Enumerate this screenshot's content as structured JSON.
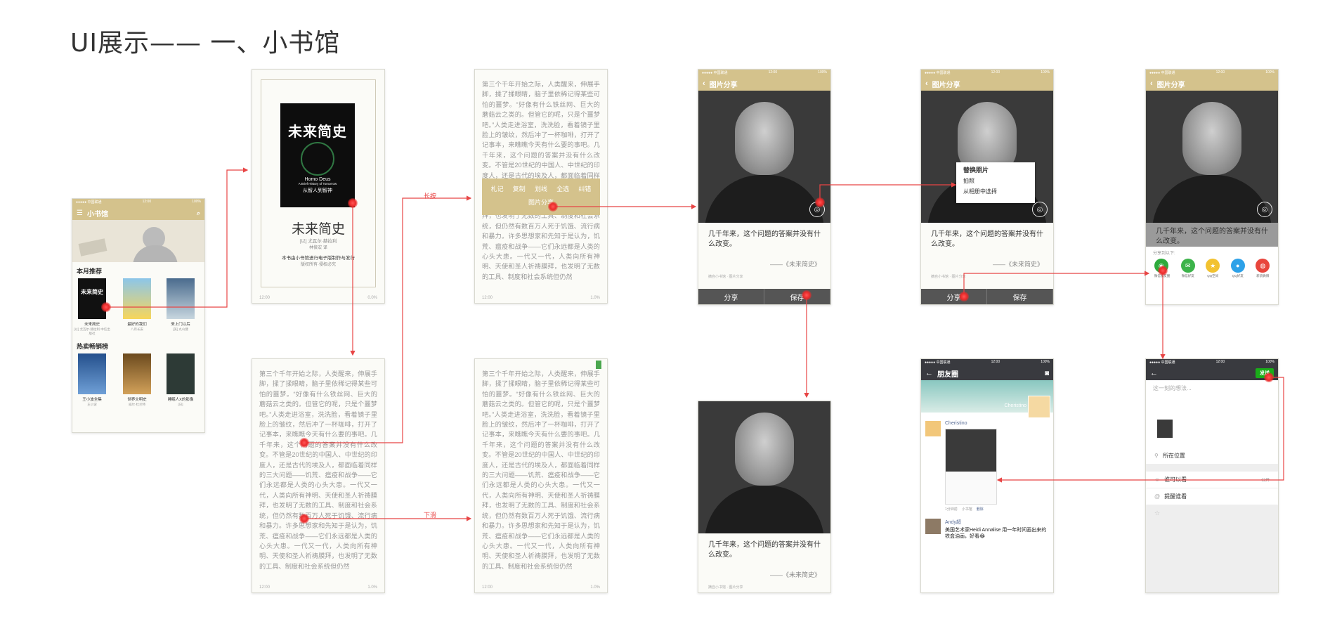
{
  "page": {
    "title": "UI展示—— 一、小书馆"
  },
  "flow_labels": {
    "long_press": "长按",
    "slide_down": "下滑"
  },
  "home": {
    "status_left": "●●●●● 中国联通",
    "status_time": "12:00",
    "status_right": "100%",
    "nav_title": "小书馆",
    "section_recommend": "本月推荐",
    "section_hot": "热卖畅销榜",
    "recommend_books": [
      {
        "title": "未来简史",
        "author": "[以] 尤瓦尔·赫拉利 中信出版社"
      },
      {
        "title": "最好的我们",
        "author": "八月长安"
      },
      {
        "title": "来上门以后",
        "author": "[美] 丸山健"
      }
    ],
    "hot_books": [
      {
        "title": "王小波全集",
        "author": "王小波"
      },
      {
        "title": "世界文明史",
        "author": "威尔·杜兰特"
      },
      {
        "title": "睡眠人X的影像",
        "author": "[日]"
      }
    ]
  },
  "cover": {
    "book_cover_title": "未来简史",
    "book_cover_en": "Homo Deus",
    "book_cover_en_sub": "A Brief History of Tomorrow",
    "book_cover_cn_sub": "从智人到智神",
    "title": "未来简史",
    "author": "[以] 尤瓦尔·赫拉利",
    "translator": "林俊宏 译",
    "note1": "本书由小书馆进行电子版制作与发行",
    "note2": "版权所有·侵权必究",
    "foot_left": "12:00",
    "foot_right": "0.0%"
  },
  "reader": {
    "text": "第三个千年开始之际，人类醒来，伸展手脚，揉了揉眼睛，脑子里依稀记得某些可怕的噩梦。“好像有什么铁丝网、巨大的蘑菇云之类的。但管它的呢，只是个噩梦吧。”人类走进浴室，洗洗脸，看着镜子里脸上的皱纹，然后冲了一杯咖啡，打开了记事本，来瞧瞧今天有什么要的事吧。几千年来，这个问题的答案并没有什么改变。不管是20世纪的中国人、中世纪的印度人，还是古代的埃及人，都面临着同样的三大问题——饥荒、瘟疫和战争——它们永远都是人类的心头大患。一代又一代，人类向所有神明、天使和圣人祈祷膜拜，也发明了无数的工具、制度和社会系统，但仍然有数百万人死于饥饿、流行病和暴力。许多思想家和先知于是认为，饥荒、瘟疫和战争——它们永远都是人类的心头大患。一代又一代，人类向所有神明、天使和圣人祈祷膜拜，也发明了无数的工具、制度和社会系统但仍然",
    "menu_items": [
      "札记",
      "复制",
      "划线",
      "全选",
      "纠错"
    ],
    "menu_share": "图片分享",
    "foot_left": "12:00",
    "foot_right": "1.0%"
  },
  "share": {
    "status_left": "●●●●● 中国联通",
    "status_time": "12:00",
    "status_right": "100%",
    "nav_title": "图片分享",
    "quote": "几千年来，这个问题的答案并没有什么改变。",
    "source": "——《未来简史》",
    "tiny": "摘自小书馆 · 图片分享",
    "btn_share": "分享",
    "btn_save": "保存",
    "popup_title": "替换照片",
    "popup_opt1": "拍照",
    "popup_opt2": "从相册中选择",
    "share_to": "分享到以下:",
    "share_targets": [
      {
        "label": "微信朋友圈",
        "color": "#2eaa3d",
        "icon": "moments-icon"
      },
      {
        "label": "微信好友",
        "color": "#3cb34a",
        "icon": "wechat-icon"
      },
      {
        "label": "QQ空间",
        "color": "#f2c230",
        "icon": "qzone-icon"
      },
      {
        "label": "QQ好友",
        "color": "#2da1e8",
        "icon": "qq-icon"
      },
      {
        "label": "新浪微博",
        "color": "#e8453c",
        "icon": "weibo-icon"
      }
    ]
  },
  "moments": {
    "status_left": "●●●●● 中国联通",
    "status_time": "12:00",
    "status_right": "100%",
    "nav_title": "朋友圈",
    "cover_name": "Cheristino",
    "post1_name": "Cheristino",
    "post1_meta": "1分钟前",
    "post1_source": "小书馆",
    "post1_delete": "删除",
    "post2_name": "Andy超",
    "post2_text": "美国艺术家Heidi Annalise 用一年时间画出来的铁盒油画，好看😂"
  },
  "compose": {
    "status_left": "●●●●● 中国联通",
    "status_time": "12:00",
    "status_right": "100%",
    "send": "发送",
    "placeholder": "这一刻的想法...",
    "location": "所在位置",
    "visibility": "谁可以看",
    "visibility_value": "公开",
    "remind": "提醒谁看"
  }
}
